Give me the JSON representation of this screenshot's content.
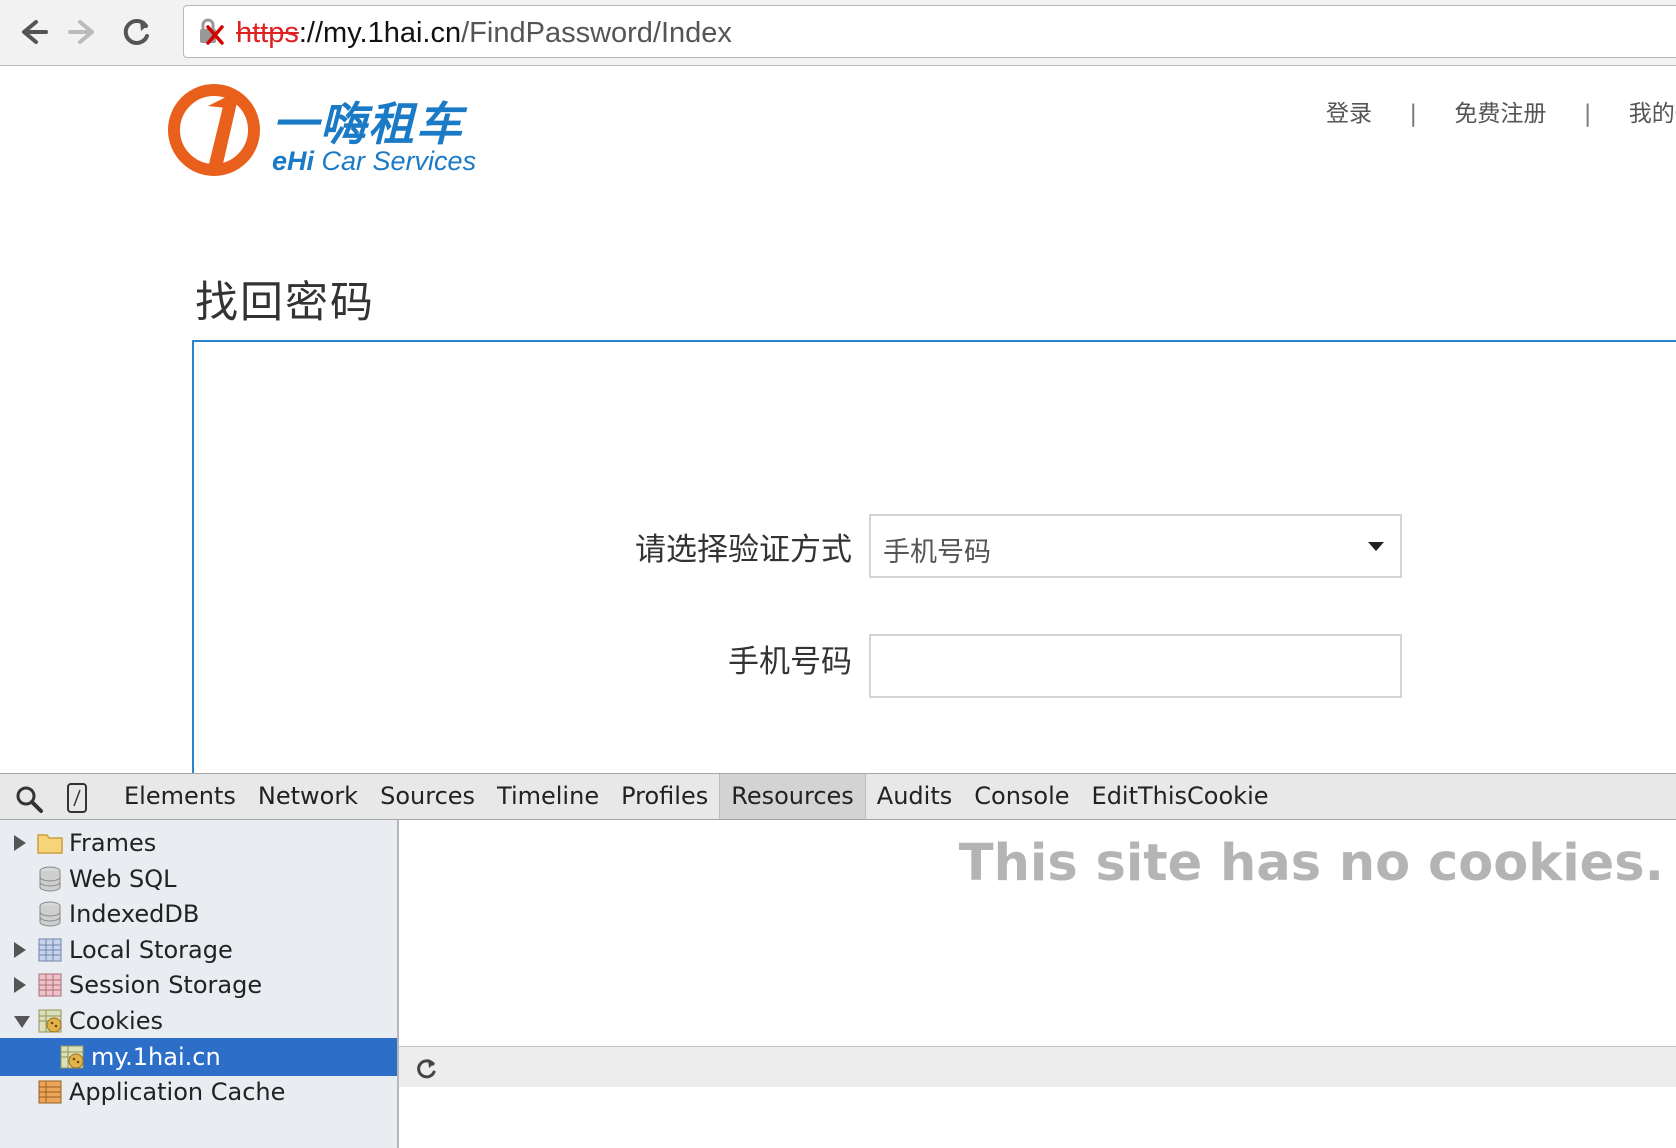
{
  "browser": {
    "url_scheme": "https",
    "url_host": "://my.1hai.cn",
    "url_path": "/FindPassword/Index",
    "icons": {
      "back": "back-arrow-icon",
      "forward": "forward-arrow-icon",
      "reload": "reload-icon",
      "security": "insecure-lock-icon"
    }
  },
  "site": {
    "logo_cn": "一嗨租车",
    "logo_en_brand": "eHi",
    "logo_en_rest": " Car Services",
    "nav": {
      "login": "登录",
      "sep1": "|",
      "register": "免费注册",
      "sep2": "|",
      "my_account": "我的一嗨"
    },
    "page_title": "找回密码",
    "form": {
      "method_label": "请选择验证方式",
      "method_value": "手机号码",
      "phone_label": "手机号码",
      "phone_value": ""
    },
    "colors": {
      "brand_blue": "#1b7ac6",
      "brand_orange": "#e8601c",
      "form_border": "#2a86cc"
    }
  },
  "devtools": {
    "tabs": [
      "Elements",
      "Network",
      "Sources",
      "Timeline",
      "Profiles",
      "Resources",
      "Audits",
      "Console",
      "EditThisCookie"
    ],
    "active_tab": "Resources",
    "tree": [
      {
        "label": "Frames",
        "icon": "folder-icon",
        "expander": "collapsed"
      },
      {
        "label": "Web SQL",
        "icon": "database-icon",
        "expander": "none"
      },
      {
        "label": "IndexedDB",
        "icon": "database-icon",
        "expander": "none"
      },
      {
        "label": "Local Storage",
        "icon": "storage-grid-icon",
        "expander": "collapsed"
      },
      {
        "label": "Session Storage",
        "icon": "session-grid-icon",
        "expander": "collapsed"
      },
      {
        "label": "Cookies",
        "icon": "cookie-icon",
        "expander": "expanded"
      },
      {
        "label": "my.1hai.cn",
        "icon": "cookie-icon",
        "expander": "none",
        "selected": true
      },
      {
        "label": "Application Cache",
        "icon": "app-cache-icon",
        "expander": "none"
      }
    ],
    "empty_message": "This site has no cookies.",
    "colors": {
      "selection": "#2d6ec9"
    }
  }
}
